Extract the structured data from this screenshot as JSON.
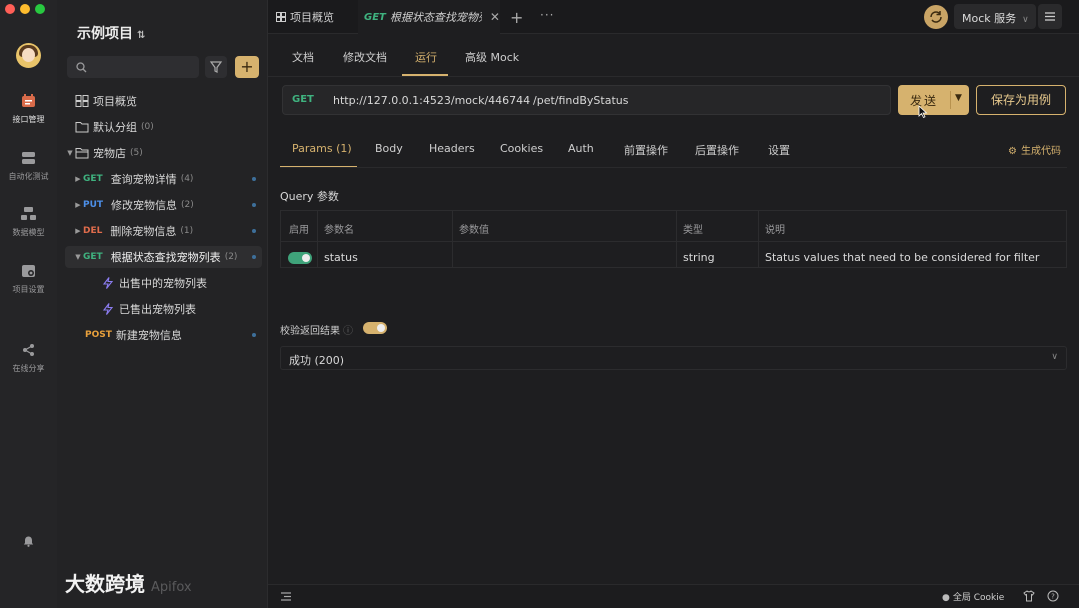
{
  "window": {
    "traffic_colors": [
      "#ff5f57",
      "#febc2e",
      "#28c840"
    ]
  },
  "rail": {
    "items": [
      {
        "label": "接口管理",
        "icon": "api-icon",
        "active": true
      },
      {
        "label": "自动化测试",
        "icon": "automation-icon",
        "active": false
      },
      {
        "label": "数据模型",
        "icon": "data-model-icon",
        "active": false
      },
      {
        "label": "项目设置",
        "icon": "project-settings-icon",
        "active": false
      },
      {
        "label": "在线分享",
        "icon": "share-icon",
        "active": false
      }
    ]
  },
  "project": {
    "title": "示例项目"
  },
  "search": {
    "value": "",
    "placeholder": ""
  },
  "tree": {
    "items": [
      {
        "kind": "overview",
        "label": "项目概览"
      },
      {
        "kind": "folder",
        "label": "默认分组",
        "count": "(0)"
      },
      {
        "kind": "folder-open",
        "label": "宠物店",
        "count": "(5)"
      },
      {
        "kind": "api",
        "method": "GET",
        "label": "查询宠物详情",
        "count": "(4)"
      },
      {
        "kind": "api",
        "method": "PUT",
        "label": "修改宠物信息",
        "count": "(2)"
      },
      {
        "kind": "api",
        "method": "DEL",
        "label": "删除宠物信息",
        "count": "(1)"
      },
      {
        "kind": "api-open",
        "method": "GET",
        "label": "根据状态查找宠物列表",
        "count": "(2)"
      },
      {
        "kind": "case",
        "label": "出售中的宠物列表"
      },
      {
        "kind": "case",
        "label": "已售出宠物列表"
      },
      {
        "kind": "api",
        "method": "POST",
        "label": "新建宠物信息",
        "count": ""
      }
    ]
  },
  "watermark": {
    "text": "大数跨境",
    "brand": "Apifox"
  },
  "tabs": {
    "overview_label": "项目概览",
    "active_method": "GET",
    "active_label": "根据状态查找宠物列"
  },
  "env": {
    "label": "Mock 服务"
  },
  "subtabs": [
    "文档",
    "修改文档",
    "运行",
    "高级 Mock"
  ],
  "request": {
    "method": "GET",
    "base_url": "http://127.0.0.1:4523/mock/446744",
    "path": "/pet/findByStatus",
    "send_label": "发送",
    "save_label": "保存为用例"
  },
  "param_tabs": [
    "Params (1)",
    "Body",
    "Headers",
    "Cookies",
    "Auth",
    "前置操作",
    "后置操作",
    "设置"
  ],
  "gen_code_label": "生成代码",
  "query": {
    "title": "Query 参数",
    "headers": [
      "启用",
      "参数名",
      "参数值",
      "类型",
      "说明"
    ],
    "rows": [
      {
        "enabled": true,
        "name": "status",
        "value": "",
        "type": "string",
        "desc": "Status values that need to be considered for filter"
      }
    ]
  },
  "verify": {
    "label": "校验返回结果",
    "enabled": true,
    "result": "成功 (200)"
  },
  "statusbar": {
    "cookie_label": "全局 Cookie"
  },
  "colors": {
    "accent": "#d6b26e",
    "get": "#3fb27f",
    "put": "#4c8fe8",
    "del": "#e06c4c",
    "post": "#e8a03c",
    "toggle_on_green": "#3fa37a"
  }
}
